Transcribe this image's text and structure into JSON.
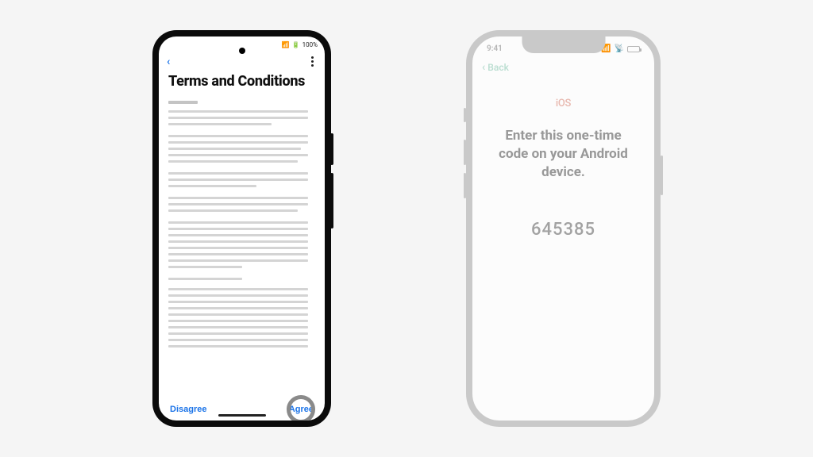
{
  "android": {
    "status": {
      "time_glyph": "▾",
      "wifi_glyph": "▲",
      "signal_glyph": "▮",
      "battery_text": "100%"
    },
    "title": "Terms and Conditions",
    "footer": {
      "disagree_label": "Disagree",
      "agree_label": "Agree"
    }
  },
  "iphone": {
    "status": {
      "time": "9:41",
      "signal_glyph": "▪",
      "wifi_glyph": "▾"
    },
    "nav": {
      "back_label": "Back"
    },
    "logo_text": "iOS",
    "headline": "Enter this one-time code on your Android device.",
    "code": "645385"
  }
}
